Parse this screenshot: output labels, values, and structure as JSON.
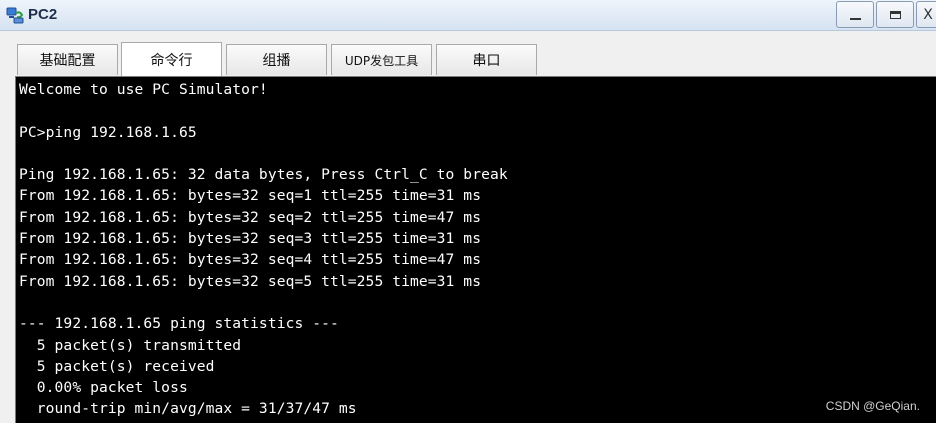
{
  "window": {
    "title": "PC2",
    "icon": "pc-simulator-icon",
    "controls": {
      "minimize_icon": "minimize-icon",
      "maximize_icon": "maximize-icon",
      "close_label": "X"
    }
  },
  "tabs": [
    {
      "label": "基础配置",
      "active": false
    },
    {
      "label": "命令行",
      "active": true
    },
    {
      "label": "组播",
      "active": false
    },
    {
      "label": "UDP发包工具",
      "active": false
    },
    {
      "label": "串口",
      "active": false
    }
  ],
  "terminal": {
    "background": "#000000",
    "foreground": "#ffffff",
    "lines": [
      "Welcome to use PC Simulator!",
      "",
      "PC>ping 192.168.1.65",
      "",
      "Ping 192.168.1.65: 32 data bytes, Press Ctrl_C to break",
      "From 192.168.1.65: bytes=32 seq=1 ttl=255 time=31 ms",
      "From 192.168.1.65: bytes=32 seq=2 ttl=255 time=47 ms",
      "From 192.168.1.65: bytes=32 seq=3 ttl=255 time=31 ms",
      "From 192.168.1.65: bytes=32 seq=4 ttl=255 time=47 ms",
      "From 192.168.1.65: bytes=32 seq=5 ttl=255 time=31 ms",
      "",
      "--- 192.168.1.65 ping statistics ---",
      "  5 packet(s) transmitted",
      "  5 packet(s) received",
      "  0.00% packet loss",
      "  round-trip min/avg/max = 31/37/47 ms"
    ]
  },
  "watermark": "CSDN @GeQian."
}
